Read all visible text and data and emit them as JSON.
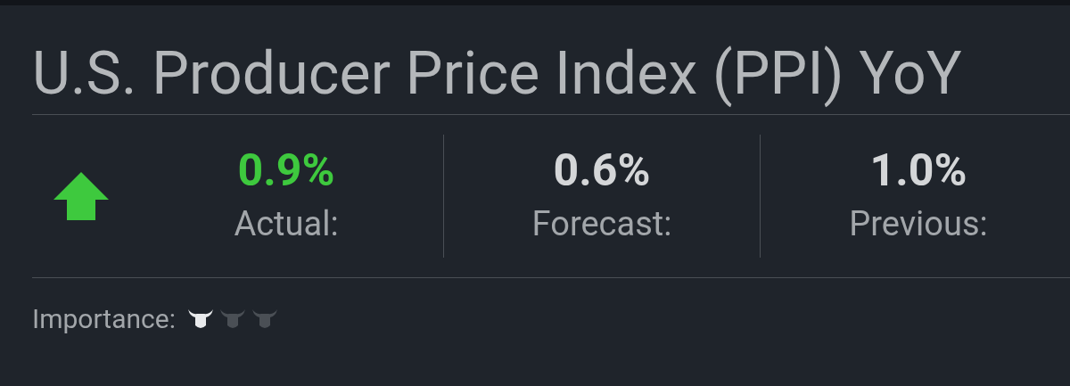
{
  "title": "U.S. Producer Price Index (PPI) YoY",
  "trend": {
    "kind": "up"
  },
  "stats": [
    {
      "value": "0.9%",
      "label": "Actual:",
      "color": "#3ec93e"
    },
    {
      "value": "0.6%",
      "label": "Forecast:",
      "color": "#d4d6d8"
    },
    {
      "value": "1.0%",
      "label": "Previous:",
      "color": "#d4d6d8"
    }
  ],
  "importance": {
    "label": "Importance:",
    "stars": 1
  }
}
